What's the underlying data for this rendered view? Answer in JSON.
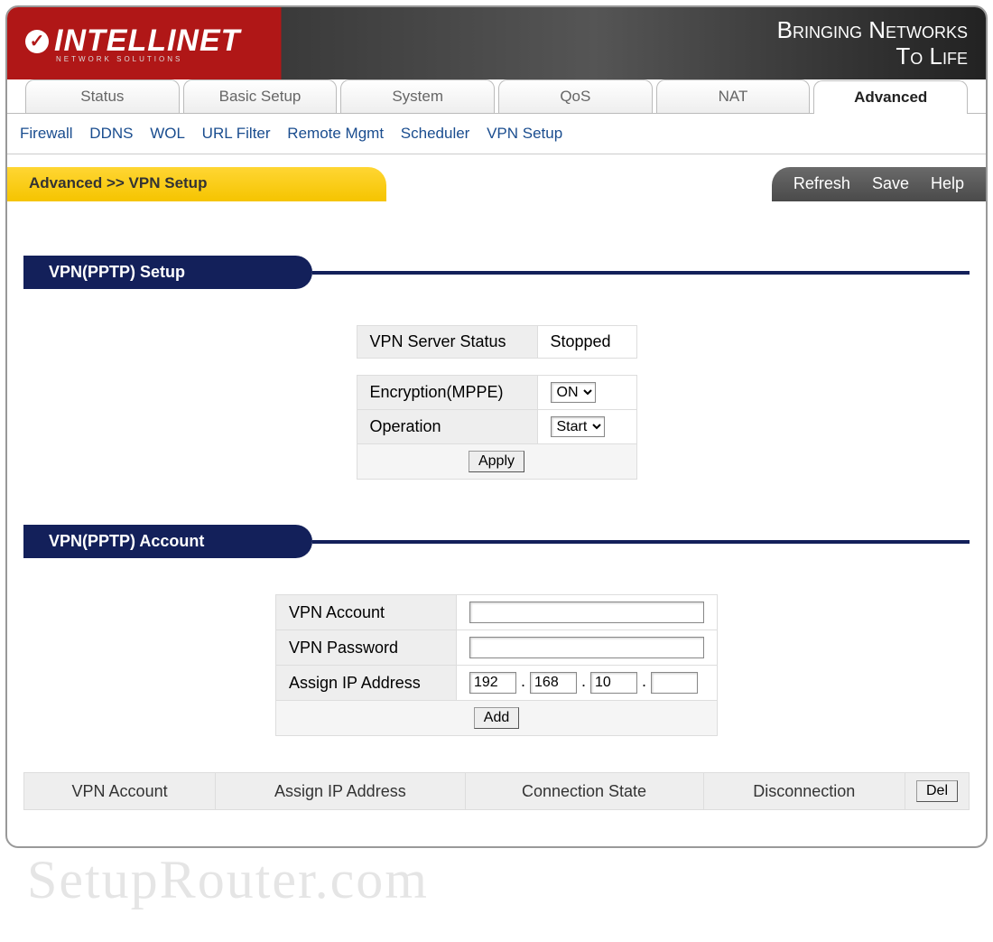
{
  "header": {
    "brand": "INTELLINET",
    "brand_sub": "NETWORK SOLUTIONS",
    "slogan_l1": "Bringing Networks",
    "slogan_l2": "To Life"
  },
  "tabs": {
    "items": [
      "Status",
      "Basic Setup",
      "System",
      "QoS",
      "NAT",
      "Advanced"
    ],
    "active": 5
  },
  "subnav": [
    "Firewall",
    "DDNS",
    "WOL",
    "URL Filter",
    "Remote Mgmt",
    "Scheduler",
    "VPN Setup"
  ],
  "breadcrumb": "Advanced >> VPN Setup",
  "actions": {
    "refresh": "Refresh",
    "save": "Save",
    "help": "Help"
  },
  "sections": {
    "setup": {
      "title": "VPN(PPTP) Setup",
      "status_label": "VPN Server Status",
      "status_value": "Stopped",
      "encryption_label": "Encryption(MPPE)",
      "encryption_value": "ON",
      "operation_label": "Operation",
      "operation_value": "Start",
      "apply": "Apply"
    },
    "account": {
      "title": "VPN(PPTP) Account",
      "acct_label": "VPN Account",
      "acct_value": "",
      "pass_label": "VPN Password",
      "pass_value": "",
      "ip_label": "Assign IP Address",
      "ip": {
        "o1": "192",
        "o2": "168",
        "o3": "10",
        "o4": ""
      },
      "add": "Add"
    }
  },
  "list": {
    "col_account": "VPN Account",
    "col_ip": "Assign IP Address",
    "col_state": "Connection State",
    "col_disc": "Disconnection",
    "del": "Del"
  },
  "watermark": "SetupRouter.com"
}
